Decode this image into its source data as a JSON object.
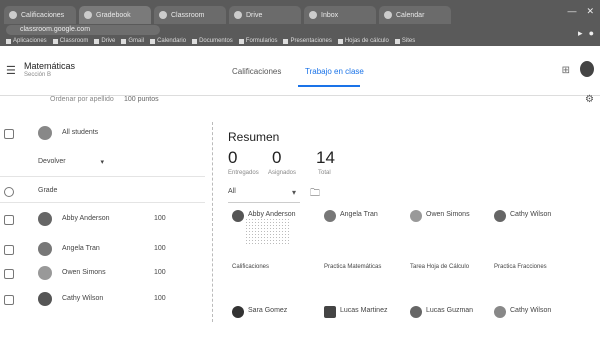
{
  "browser": {
    "tabs": [
      "Calificaciones",
      "Gradebook",
      "Classroom",
      "Drive",
      "Inbox",
      "Calendar"
    ],
    "url": "classroom.google.com",
    "bookmarks": [
      "Aplicaciones",
      "Classroom",
      "Drive",
      "Gmail",
      "Calendario",
      "Documentos",
      "Formularios",
      "Presentaciones",
      "Hojas de cálculo",
      "Sites"
    ]
  },
  "app": {
    "course_title": "Matemáticas",
    "course_subtitle": "Sección B",
    "nav_tabs": [
      "Calificaciones",
      "Trabajo en clase"
    ],
    "grid_icon": "apps-grid-icon",
    "settings_icon": "gear-icon"
  },
  "toolbar": {
    "student_sort": "Ordenar por apellido",
    "grade_header": "100 puntos"
  },
  "class_row": {
    "name": "All students"
  },
  "action_select": {
    "label": "Devolver"
  },
  "section_label": "Grade",
  "students": [
    {
      "name": "Abby Anderson",
      "grade": "100"
    },
    {
      "name": "Angela Tran",
      "grade": "100"
    },
    {
      "name": "Owen Simons",
      "grade": "100"
    },
    {
      "name": "Cathy Wilson",
      "grade": "100"
    }
  ],
  "summary": {
    "title": "Resumen",
    "stats": [
      {
        "value": "0",
        "label": "Entregados"
      },
      {
        "value": "0",
        "label": "Asignados"
      },
      {
        "value": "14",
        "label": "Total"
      }
    ],
    "filter": "All"
  },
  "cards_row1": [
    "Abby Anderson",
    "Angela Tran",
    "Owen Simons",
    "Cathy Wilson"
  ],
  "docs_row": [
    "Calificaciones",
    "Practica Matemáticas",
    "Tarea Hoja de Cálculo",
    "Practica Fracciones"
  ],
  "cards_row2": [
    "Sara Gomez",
    "Lucas Martinez",
    "Lucas Guzman",
    "Cathy Wilson"
  ]
}
